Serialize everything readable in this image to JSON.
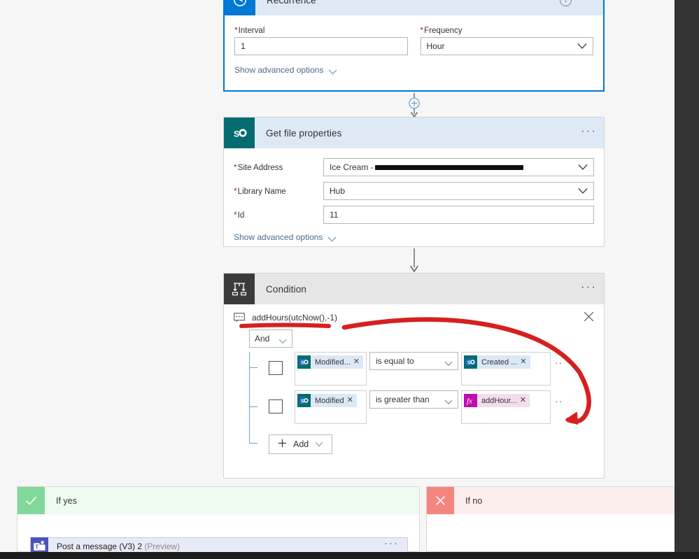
{
  "canvas": {
    "background": "#f6f6f6",
    "accent": "#0078d4",
    "annotation_color": "#d62020"
  },
  "recurrence_card": {
    "title": "Recurrence",
    "icon": "clock-icon",
    "selected": true,
    "info_glyph": "i",
    "ellipsis": "···",
    "fields": [
      {
        "label": "Interval",
        "required": true,
        "value": "1",
        "type": "text"
      },
      {
        "label": "Frequency",
        "required": true,
        "value": "Hour",
        "type": "select"
      }
    ],
    "advanced_label": "Show advanced options"
  },
  "getfile_card": {
    "title": "Get file properties",
    "icon": "sharepoint-icon",
    "ellipsis": "···",
    "fields": [
      {
        "label": "Site Address",
        "required": true,
        "value": "Ice Cream -",
        "redacted": true,
        "type": "select"
      },
      {
        "label": "Library Name",
        "required": true,
        "value": "Hub",
        "type": "select"
      },
      {
        "label": "Id",
        "required": true,
        "value": "11",
        "type": "text"
      }
    ],
    "advanced_label": "Show advanced options"
  },
  "condition_card": {
    "title": "Condition",
    "icon": "condition-branch-icon",
    "ellipsis": "···",
    "expression": {
      "icon": "tooltip-icon",
      "text": "addHours(utcNow(),-1)",
      "close_icon": "close-icon"
    },
    "operator": "And",
    "rows": [
      {
        "left_token": {
          "label": "Modified...",
          "icon": "sharepoint-icon",
          "remove": "✕"
        },
        "operator": "is equal to",
        "right_token": {
          "label": "Created ...",
          "icon": "sharepoint-icon",
          "remove": "✕"
        },
        "row_menu": "··"
      },
      {
        "left_token": {
          "label": "Modified",
          "icon": "sharepoint-icon",
          "remove": "✕"
        },
        "operator": "is greater than",
        "right_token": {
          "label": "addHour...",
          "icon": "function-fx-icon",
          "remove": "✕"
        },
        "row_menu": "··"
      }
    ],
    "add_label": "Add"
  },
  "branches": {
    "yes": {
      "title": "If yes",
      "icon": "checkmark-icon",
      "action": {
        "title": "Post a message (V3) 2",
        "preview_tag": "(Preview)",
        "icon": "teams-icon",
        "ellipsis": "···"
      }
    },
    "no": {
      "title": "If no",
      "icon": "cross-icon"
    }
  },
  "connectors": {
    "insert_label": "+",
    "arrow": "↓"
  }
}
